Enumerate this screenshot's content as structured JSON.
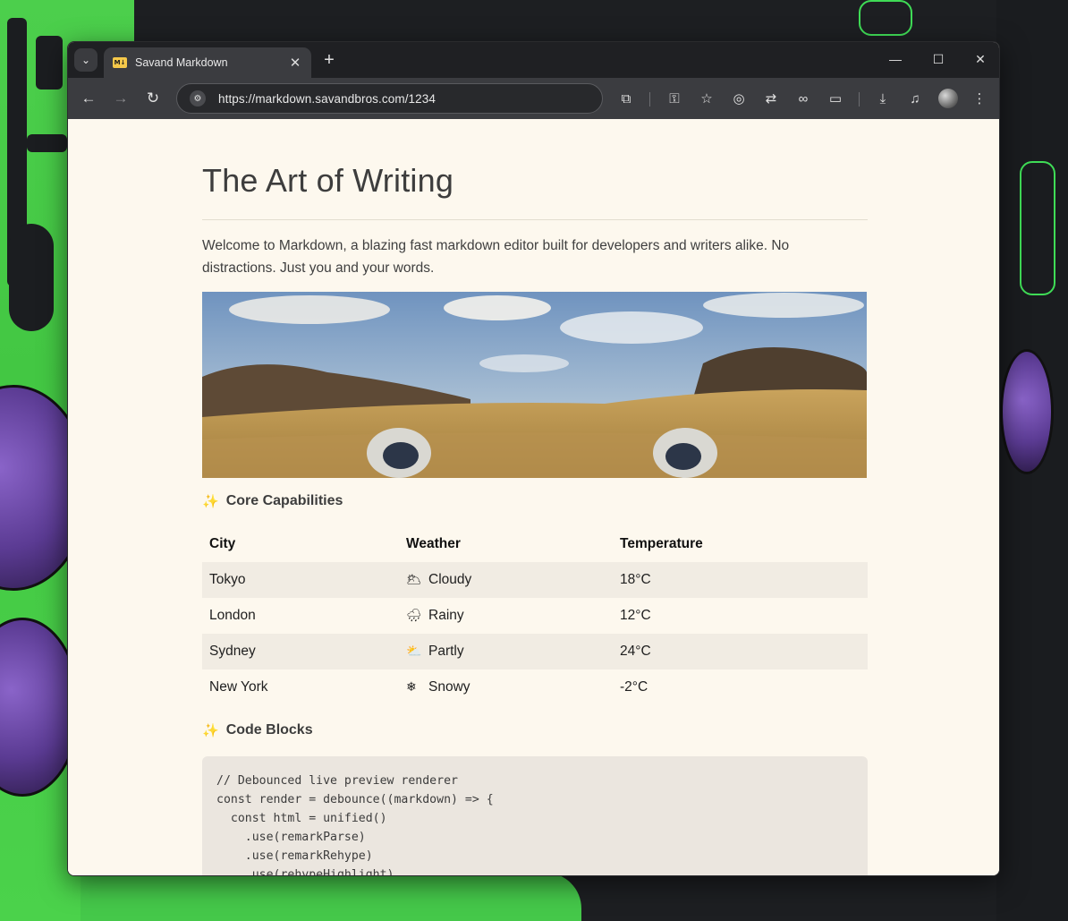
{
  "browser": {
    "tab_title": "Savand Markdown",
    "tab_favicon_text": "M↓",
    "new_tab_label": "+",
    "url": "https://markdown.savandbros.com/1234"
  },
  "document": {
    "title": "The Art of Writing",
    "intro": "Welcome to Markdown, a blazing fast markdown editor built for developers and writers alike. No distractions. Just you and your words.",
    "section_capabilities": "Core Capabilities",
    "section_code": "Code Blocks",
    "table": {
      "headers": [
        "City",
        "Weather",
        "Temperature"
      ],
      "rows": [
        {
          "city": "Tokyo",
          "weather_icon": "🌥",
          "weather": "Cloudy",
          "temp": "18°C"
        },
        {
          "city": "London",
          "weather_icon": "🌧",
          "weather": "Rainy",
          "temp": "12°C"
        },
        {
          "city": "Sydney",
          "weather_icon": "⛅",
          "weather": "Partly",
          "temp": "24°C"
        },
        {
          "city": "New York",
          "weather_icon": "❄",
          "weather": "Snowy",
          "temp": "-2°C"
        }
      ]
    },
    "code_lines": [
      "// Debounced live preview renderer",
      "const render = debounce((markdown) => {",
      "  const html = unified()",
      "    .use(remarkParse)",
      "    .use(remarkRehype)",
      "    .use(rehypeHighlight)"
    ]
  },
  "colors": {
    "page_bg": "#fdf8ee",
    "tab_strip": "#1f2023",
    "toolbar": "#3b3c40"
  }
}
